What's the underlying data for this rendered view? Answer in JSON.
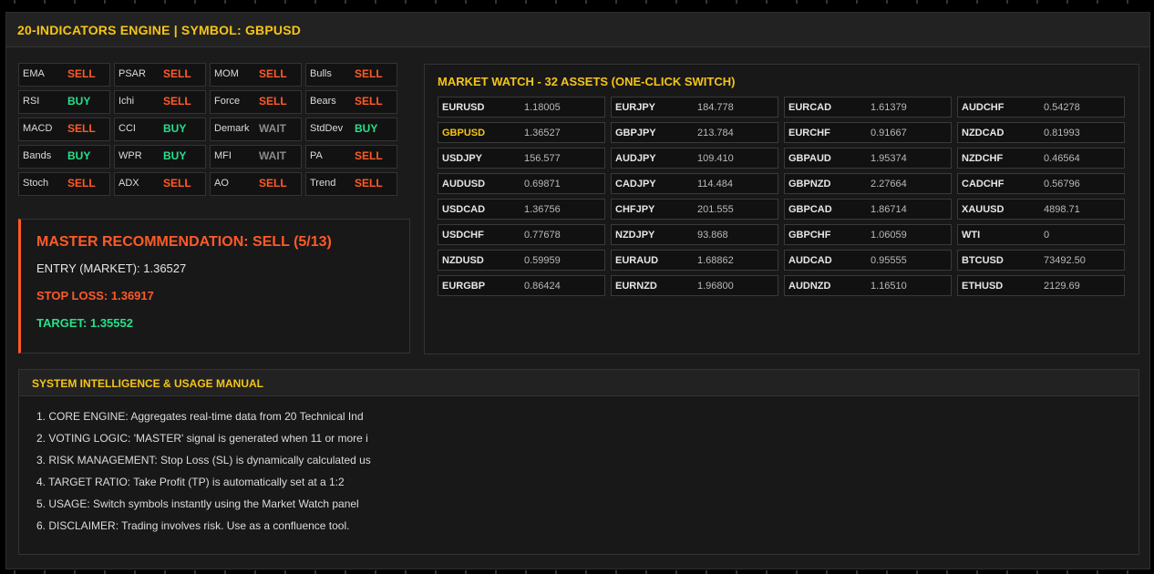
{
  "app": {
    "title": "20-INDICATORS ENGINE | SYMBOL: GBPUSD"
  },
  "colors": {
    "accent": "#f5c518",
    "sell": "#ff5a28",
    "buy": "#27e08a",
    "wait": "#8a8a8a",
    "background": "#1b1b1b"
  },
  "indicators": [
    {
      "name": "EMA",
      "signal": "SELL",
      "state": "sell"
    },
    {
      "name": "PSAR",
      "signal": "SELL",
      "state": "sell"
    },
    {
      "name": "MOM",
      "signal": "SELL",
      "state": "sell"
    },
    {
      "name": "Bulls",
      "signal": "SELL",
      "state": "sell"
    },
    {
      "name": "RSI",
      "signal": "BUY",
      "state": "buy"
    },
    {
      "name": "Ichi",
      "signal": "SELL",
      "state": "sell"
    },
    {
      "name": "Force",
      "signal": "SELL",
      "state": "sell"
    },
    {
      "name": "Bears",
      "signal": "SELL",
      "state": "sell"
    },
    {
      "name": "MACD",
      "signal": "SELL",
      "state": "sell"
    },
    {
      "name": "CCI",
      "signal": "BUY",
      "state": "buy"
    },
    {
      "name": "Demark",
      "signal": "WAIT",
      "state": "wait"
    },
    {
      "name": "StdDev",
      "signal": "BUY",
      "state": "buy"
    },
    {
      "name": "Bands",
      "signal": "BUY",
      "state": "buy"
    },
    {
      "name": "WPR",
      "signal": "BUY",
      "state": "buy"
    },
    {
      "name": "MFI",
      "signal": "WAIT",
      "state": "wait"
    },
    {
      "name": "PA",
      "signal": "SELL",
      "state": "sell"
    },
    {
      "name": "Stoch",
      "signal": "SELL",
      "state": "sell"
    },
    {
      "name": "ADX",
      "signal": "SELL",
      "state": "sell"
    },
    {
      "name": "AO",
      "signal": "SELL",
      "state": "sell"
    },
    {
      "name": "Trend",
      "signal": "SELL",
      "state": "sell"
    }
  ],
  "master": {
    "title": "MASTER RECOMMENDATION: SELL (5/13)",
    "entry": "ENTRY (MARKET): 1.36527",
    "stop_loss": "STOP LOSS: 1.36917",
    "target": "TARGET: 1.35552"
  },
  "market_watch": {
    "title": "MARKET WATCH - 32 ASSETS (ONE-CLICK SWITCH)",
    "active_symbol": "GBPUSD",
    "assets": [
      {
        "symbol": "EURUSD",
        "price": "1.18005"
      },
      {
        "symbol": "GBPUSD",
        "price": "1.36527"
      },
      {
        "symbol": "USDJPY",
        "price": "156.577"
      },
      {
        "symbol": "AUDUSD",
        "price": "0.69871"
      },
      {
        "symbol": "USDCAD",
        "price": "1.36756"
      },
      {
        "symbol": "USDCHF",
        "price": "0.77678"
      },
      {
        "symbol": "NZDUSD",
        "price": "0.59959"
      },
      {
        "symbol": "EURGBP",
        "price": "0.86424"
      },
      {
        "symbol": "EURJPY",
        "price": "184.778"
      },
      {
        "symbol": "GBPJPY",
        "price": "213.784"
      },
      {
        "symbol": "AUDJPY",
        "price": "109.410"
      },
      {
        "symbol": "CADJPY",
        "price": "114.484"
      },
      {
        "symbol": "CHFJPY",
        "price": "201.555"
      },
      {
        "symbol": "NZDJPY",
        "price": "93.868"
      },
      {
        "symbol": "EURAUD",
        "price": "1.68862"
      },
      {
        "symbol": "EURNZD",
        "price": "1.96800"
      },
      {
        "symbol": "EURCAD",
        "price": "1.61379"
      },
      {
        "symbol": "EURCHF",
        "price": "0.91667"
      },
      {
        "symbol": "GBPAUD",
        "price": "1.95374"
      },
      {
        "symbol": "GBPNZD",
        "price": "2.27664"
      },
      {
        "symbol": "GBPCAD",
        "price": "1.86714"
      },
      {
        "symbol": "GBPCHF",
        "price": "1.06059"
      },
      {
        "symbol": "AUDCAD",
        "price": "0.95555"
      },
      {
        "symbol": "AUDNZD",
        "price": "1.16510"
      },
      {
        "symbol": "AUDCHF",
        "price": "0.54278"
      },
      {
        "symbol": "NZDCAD",
        "price": "0.81993"
      },
      {
        "symbol": "NZDCHF",
        "price": "0.46564"
      },
      {
        "symbol": "CADCHF",
        "price": "0.56796"
      },
      {
        "symbol": "XAUUSD",
        "price": "4898.71"
      },
      {
        "symbol": "WTI",
        "price": "0"
      },
      {
        "symbol": "BTCUSD",
        "price": "73492.50"
      },
      {
        "symbol": "ETHUSD",
        "price": "2129.69"
      }
    ]
  },
  "manual": {
    "title": "SYSTEM INTELLIGENCE & USAGE MANUAL",
    "items": [
      "1. CORE ENGINE: Aggregates real-time data from 20 Technical Ind",
      "2. VOTING LOGIC: 'MASTER' signal is generated when 11 or more i",
      "3. RISK MANAGEMENT: Stop Loss (SL) is dynamically calculated us",
      "4. TARGET RATIO: Take Profit (TP) is automatically set at a 1:2",
      "5. USAGE: Switch symbols instantly using the Market Watch panel",
      "6. DISCLAIMER: Trading involves risk. Use as a confluence tool."
    ]
  }
}
